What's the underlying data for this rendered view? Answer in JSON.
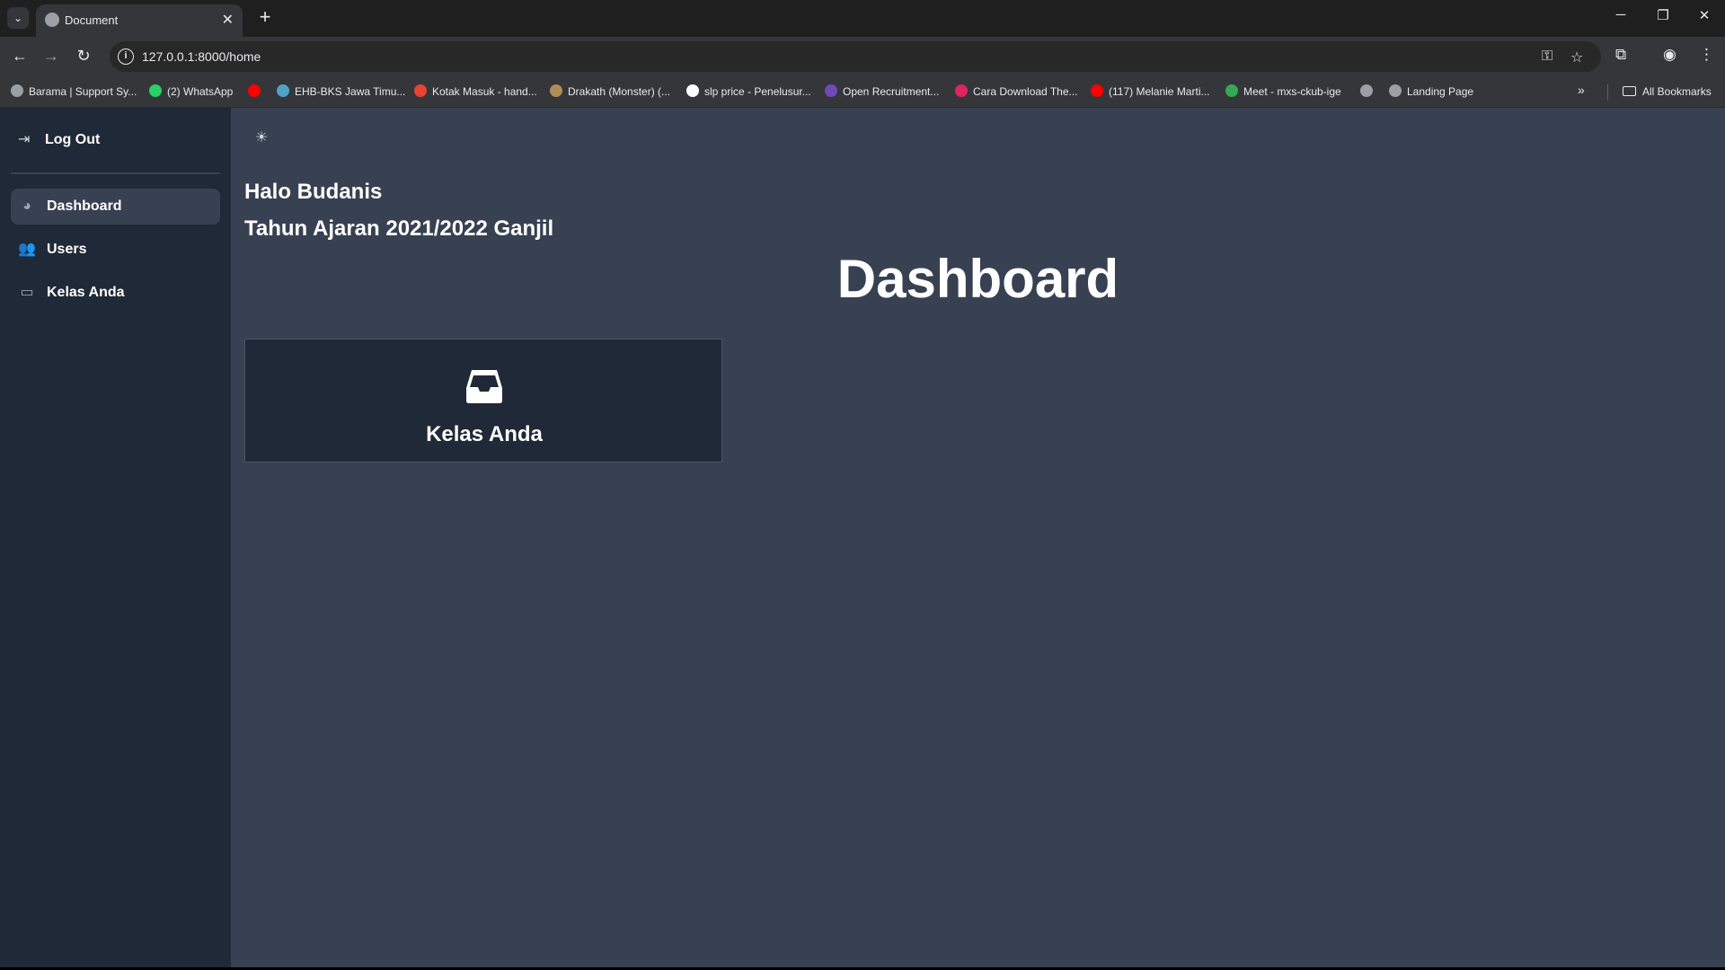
{
  "browser": {
    "tab_title": "Document",
    "tab_close": "✕",
    "new_tab": "+",
    "url": "127.0.0.1:8000/home",
    "bookmarks": [
      {
        "label": "Barama | Support Sy...",
        "icon_color": "#9aa0a6"
      },
      {
        "label": "(2) WhatsApp",
        "icon_color": "#25d366"
      },
      {
        "label": "",
        "icon_color": "#ff0000"
      },
      {
        "label": "EHB-BKS Jawa Timu...",
        "icon_color": "#4fa3c7"
      },
      {
        "label": "Kotak Masuk - hand...",
        "icon_color": "#ea4335"
      },
      {
        "label": "Drakath (Monster) (...",
        "icon_color": "#b08d57"
      },
      {
        "label": "slp price - Penelusur...",
        "icon_color": "#ffffff"
      },
      {
        "label": "Open Recruitment...",
        "icon_color": "#7248b9"
      },
      {
        "label": "Cara Download The...",
        "icon_color": "#e0245e"
      },
      {
        "label": "(117) Melanie Marti...",
        "icon_color": "#ff0000"
      },
      {
        "label": "Meet - mxs-ckub-ige",
        "icon_color": "#34a853"
      },
      {
        "label": "",
        "icon_color": "#9aa0a6"
      },
      {
        "label": "Landing Page",
        "icon_color": "#9aa0a6"
      }
    ],
    "all_bookmarks": "All Bookmarks"
  },
  "sidebar": {
    "logout_label": "Log Out",
    "items": [
      {
        "label": "Dashboard",
        "icon": "pie-chart-icon",
        "active": true
      },
      {
        "label": "Users",
        "icon": "users-icon",
        "active": false
      },
      {
        "label": "Kelas Anda",
        "icon": "inbox-icon",
        "active": false
      }
    ]
  },
  "main": {
    "greeting": "Halo Budanis",
    "academic_year": "Tahun Ajaran 2021/2022 Ganjil",
    "title": "Dashboard",
    "cards": [
      {
        "label": "Kelas Anda",
        "icon": "inbox-icon"
      }
    ]
  },
  "colors": {
    "sidebar_bg": "#1f2937",
    "main_bg": "#374151",
    "text": "#ffffff"
  }
}
